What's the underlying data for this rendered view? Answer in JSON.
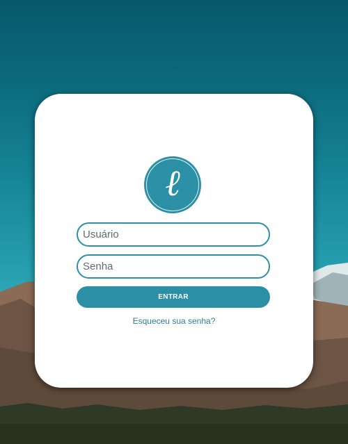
{
  "background": {
    "scene": "mountain-landscape",
    "sky_color": "#0b6a7c"
  },
  "brand": {
    "logo_letter": "ℓ",
    "logo_icon": "script-l-logo-icon",
    "accent_color": "#2b8fa5"
  },
  "login": {
    "username_placeholder": "Usuário",
    "username_value": "",
    "password_placeholder": "Senha",
    "password_value": "",
    "submit_label": "ENTRAR",
    "forgot_label": "Esqueceu sua senha?"
  }
}
